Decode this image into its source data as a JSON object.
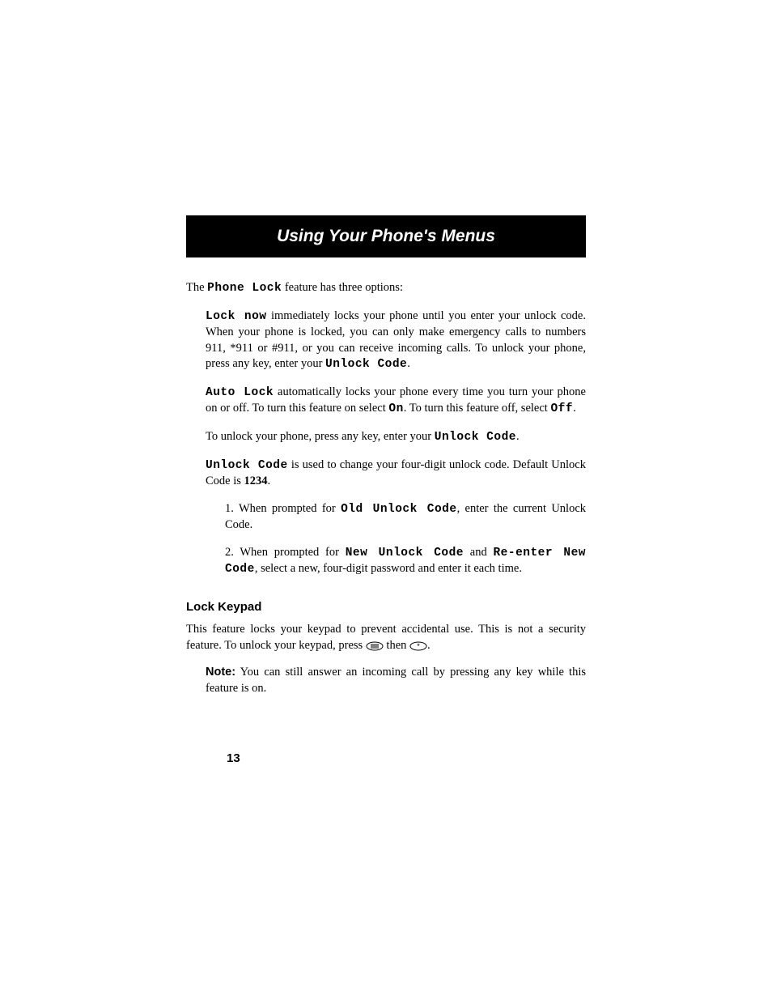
{
  "header": {
    "title": "Using Your Phone's Menus"
  },
  "p1": {
    "t1": "The ",
    "l1": "Phone Lock",
    "t2": " feature has three options:"
  },
  "p2": {
    "l1": "Lock now",
    "t1": " immediately locks your phone until you enter your unlock code. When your phone is locked, you can only make emergency calls to numbers 911, *911 or #911, or you can receive incoming calls. To unlock your phone, press any key, enter your ",
    "l2": "Unlock Code",
    "t2": "."
  },
  "p3": {
    "l1": "Auto Lock",
    "t1": " automatically locks your phone every time you turn your phone on or off. To turn this feature on select ",
    "l2": "On",
    "t2": ". To turn this feature off, select ",
    "l3": "Off",
    "t3": "."
  },
  "p4": {
    "t0": "To unlock your phone, press any key, enter your ",
    "l1": "Unlock Code",
    "t1": "."
  },
  "p5": {
    "l1": "Unlock Code",
    "t1": " is used to change your four-digit unlock code. Default Unlock Code is ",
    "b1": "1234",
    "t2": "."
  },
  "step1": {
    "t1": "1. When prompted for ",
    "l1": "Old Unlock Code",
    "t2": ", enter the current Unlock Code."
  },
  "step2": {
    "t1": "2. When prompted for ",
    "l1": "New Unlock Code",
    "t2": " and ",
    "l2": "Re-enter New Code",
    "t3": ", select a new, four-digit password and enter it each time."
  },
  "section": {
    "title": "Lock Keypad"
  },
  "p6": {
    "t1": "This feature locks your keypad to prevent accidental use. This is not a security feature. To unlock your keypad, press ",
    "t2": " then "
  },
  "note": {
    "label": "Note:",
    "text": " You can still answer an incoming call by pressing any key while this feature is on."
  },
  "pageNumber": "13",
  "keys": {
    "menu": "≡",
    "star": "*"
  }
}
